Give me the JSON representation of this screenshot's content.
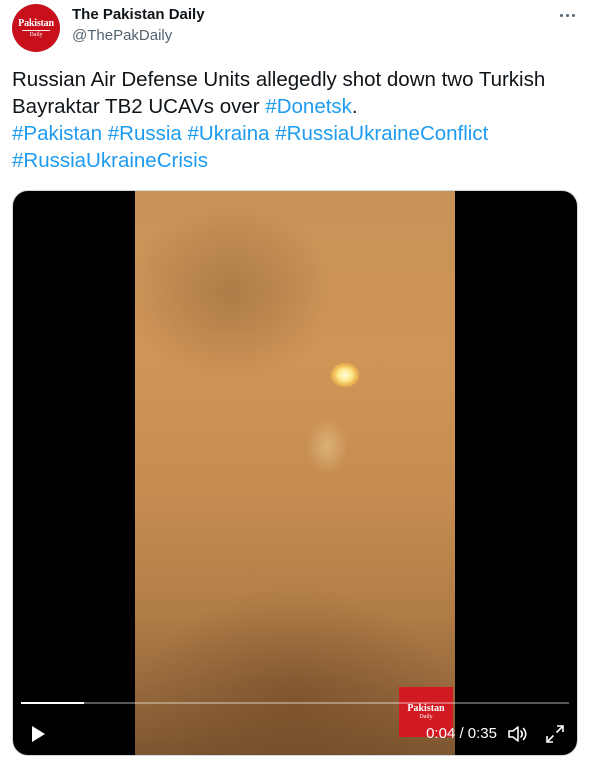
{
  "account": {
    "name": "The Pakistan Daily",
    "handle": "@ThePakDaily",
    "avatar_text": "Pakistan",
    "avatar_subtext": "Daily"
  },
  "tweet": {
    "text_before": "Russian Air Defense Units allegedly shot down two Turkish Bayraktar TB2 UCAVs over ",
    "hashtags": [
      "#Donetsk",
      "#Pakistan",
      "#Russia",
      "#Ukraina",
      "#RussiaUkraineConflict",
      "#RussiaUkraineCrisis"
    ],
    "period": "."
  },
  "video": {
    "watermark_text": "Pakistan",
    "watermark_subtext": "Daily",
    "time_display": "0:04 / 0:35",
    "progress_fraction": 0.115
  },
  "icons": {
    "more": "more-icon",
    "play": "play-icon",
    "volume": "volume-icon",
    "fullscreen": "fullscreen-icon"
  },
  "colors": {
    "link": "#1d9bf0",
    "brand_red": "#c8101c"
  }
}
